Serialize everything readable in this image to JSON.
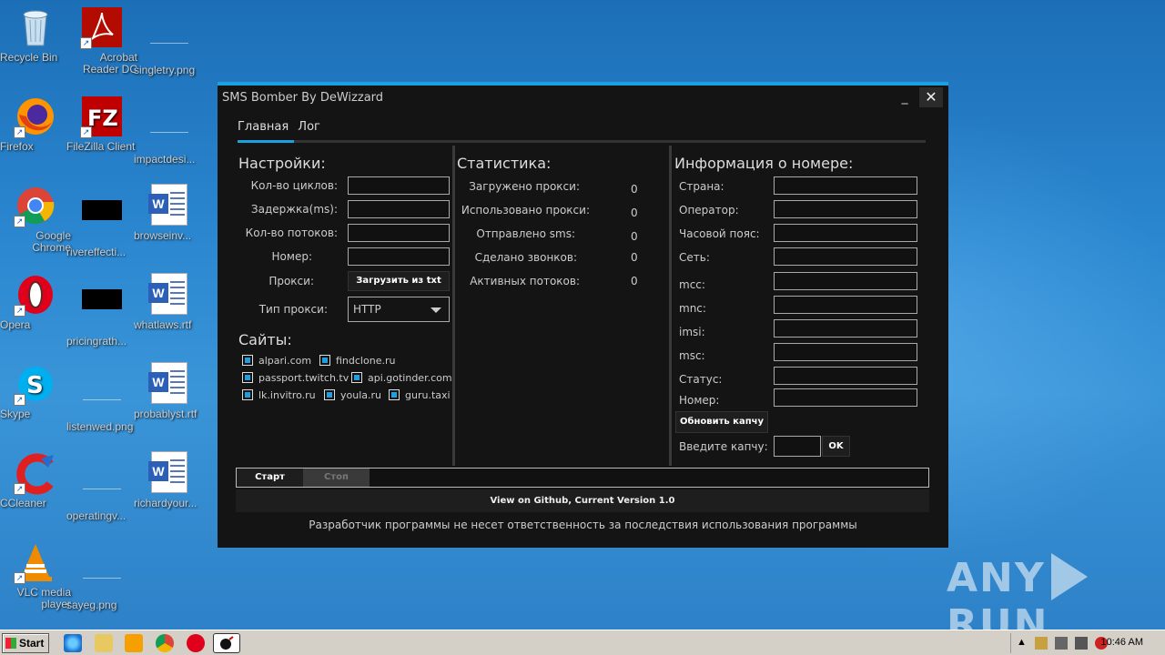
{
  "desktop": {
    "icons": [
      {
        "label": "Recycle Bin"
      },
      {
        "label": "Acrobat Reader DC"
      },
      {
        "label": "singletry.png"
      },
      {
        "label": "Firefox"
      },
      {
        "label": "FileZilla Client"
      },
      {
        "label": "impactdesi..."
      },
      {
        "label": "Google Chrome"
      },
      {
        "label": "rivereffecti..."
      },
      {
        "label": "browseinv..."
      },
      {
        "label": "Opera"
      },
      {
        "label": "pricingrath..."
      },
      {
        "label": "whatlaws.rtf"
      },
      {
        "label": "Skype"
      },
      {
        "label": "listenwed.png"
      },
      {
        "label": "probablyst.rtf"
      },
      {
        "label": "CCleaner"
      },
      {
        "label": "operatingv..."
      },
      {
        "label": "richardyour..."
      },
      {
        "label": "VLC media player"
      },
      {
        "label": "sayeg.png"
      }
    ],
    "watermark_left": "ANY",
    "watermark_right": "RUN"
  },
  "window": {
    "title": "SMS Bomber By DeWizzard",
    "minimize": "_",
    "close": "✕",
    "tabs": [
      "Главная",
      "Лог"
    ],
    "settings": {
      "title": "Настройки:",
      "cycles_label": "Кол-во циклов:",
      "delay_label": "Задержка(ms):",
      "threads_label": "Кол-во потоков:",
      "number_label": "Номер:",
      "proxy_label": "Прокси:",
      "proxy_button": "Загрузить из txt",
      "proxy_type_label": "Тип прокси:",
      "proxy_type_value": "HTTP"
    },
    "sites": {
      "title": "Сайты:",
      "items": [
        "alpari.com",
        "findclone.ru",
        "passport.twitch.tv",
        "api.gotinder.com",
        "lk.invitro.ru",
        "youla.ru",
        "guru.taxi"
      ]
    },
    "stats": {
      "title": "Статистика:",
      "rows": [
        {
          "label": "Загружено прокси:",
          "value": "0"
        },
        {
          "label": "Использовано прокси:",
          "value": "0"
        },
        {
          "label": "Отправлено sms:",
          "value": "0"
        },
        {
          "label": "Сделано звонков:",
          "value": "0"
        },
        {
          "label": "Активных потоков:",
          "value": "0"
        }
      ]
    },
    "info": {
      "title": "Информация о номере:",
      "fields": [
        "Страна:",
        "Оператор:",
        "Часовой пояс:",
        "Сеть:",
        "mcc:",
        "mnc:",
        "imsi:",
        "msc:",
        "Статус:",
        "Номер:"
      ],
      "refresh_captcha": "Обновить капчу",
      "captcha_label": "Введите капчу:",
      "ok_button": "OK"
    },
    "start_button": "Старт",
    "stop_button": "Стоп",
    "github": "View on Github, Current Version 1.0",
    "disclaimer": "Разработчик программы не несет ответственность за последствия использования программы"
  },
  "taskbar": {
    "start": "Start",
    "clock": "10:46 AM"
  },
  "colors": {
    "accent": "#1ba1e2",
    "window_bg": "#141414"
  }
}
